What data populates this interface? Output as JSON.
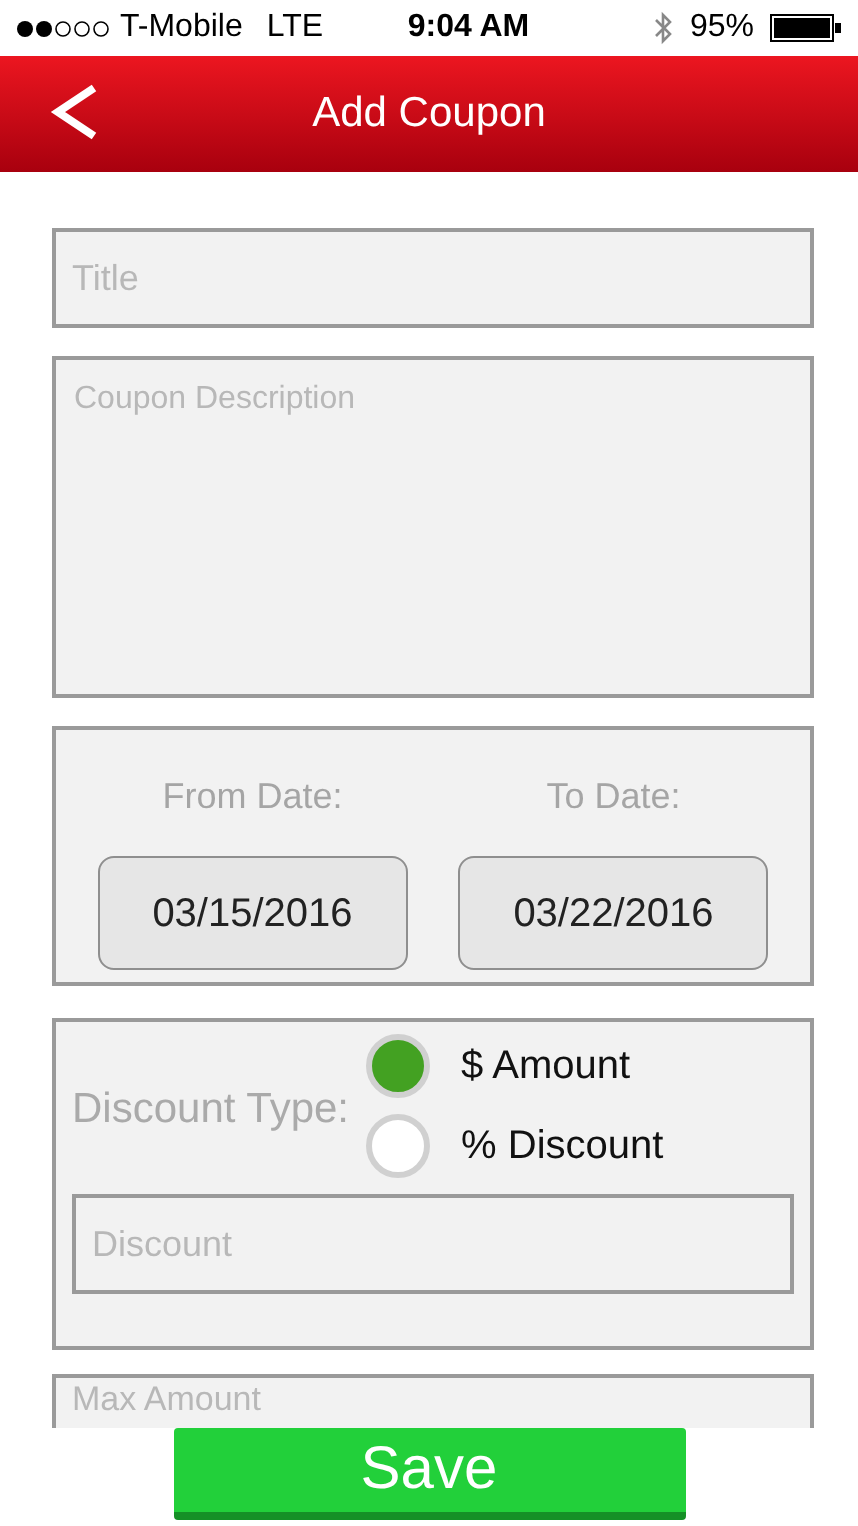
{
  "status_bar": {
    "carrier": "T-Mobile",
    "network": "LTE",
    "time": "9:04 AM",
    "battery": "95%"
  },
  "header": {
    "title": "Add Coupon"
  },
  "form": {
    "title_placeholder": "Title",
    "description_placeholder": "Coupon Description",
    "dates": [
      {
        "label": "From Date:",
        "value": "03/15/2016"
      },
      {
        "label": "To Date:",
        "value": "03/22/2016"
      }
    ],
    "discount_type": {
      "label": "Discount Type:",
      "options": [
        {
          "label": "$ Amount",
          "selected": true
        },
        {
          "label": "% Discount",
          "selected": false
        }
      ]
    },
    "discount_placeholder": "Discount",
    "max_amount_placeholder": "Max Amount"
  },
  "save_button": "Save"
}
